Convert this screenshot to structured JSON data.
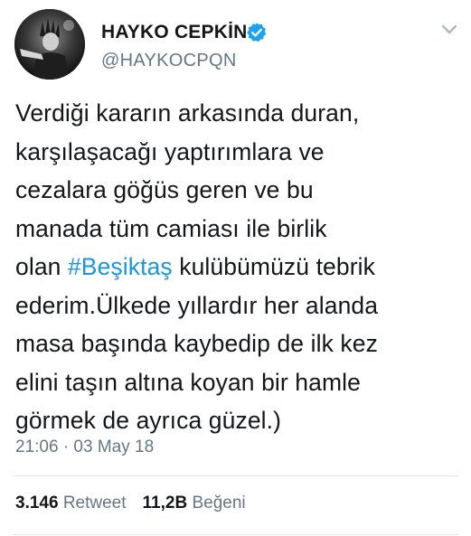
{
  "author": {
    "display_name": "HAYKO CEPKİN",
    "handle": "@HAYKOCPQN",
    "verified": true,
    "verified_color": "#1da1f2"
  },
  "tweet": {
    "lines": [
      "Verdiği kararın arkasında duran,",
      "karşılaşacağı yaptırımlara ve",
      "cezalara göğüs geren ve bu",
      "manada tüm camiası ile birlik"
    ],
    "line5_before": "olan ",
    "hashtag": "#Beşiktaş",
    "line5_after": " kulübümüzü tebrik",
    "lines_after": [
      "ederim.Ülkede yıllardır her alanda",
      "masa başında kaybedip de ilk kez",
      "elini taşın altına koyan bir hamle",
      "görmek de ayrıca güzel.)"
    ],
    "hashtag_color": "#1b95e0",
    "timestamp": "21:06 · 03 May 18"
  },
  "stats": {
    "retweets_count": "3.146",
    "retweets_label": "Retweet",
    "likes_count": "11,2B",
    "likes_label": "Beğeni"
  },
  "icons": {
    "verified": "verified-badge-icon",
    "menu": "chevron-down-icon"
  }
}
